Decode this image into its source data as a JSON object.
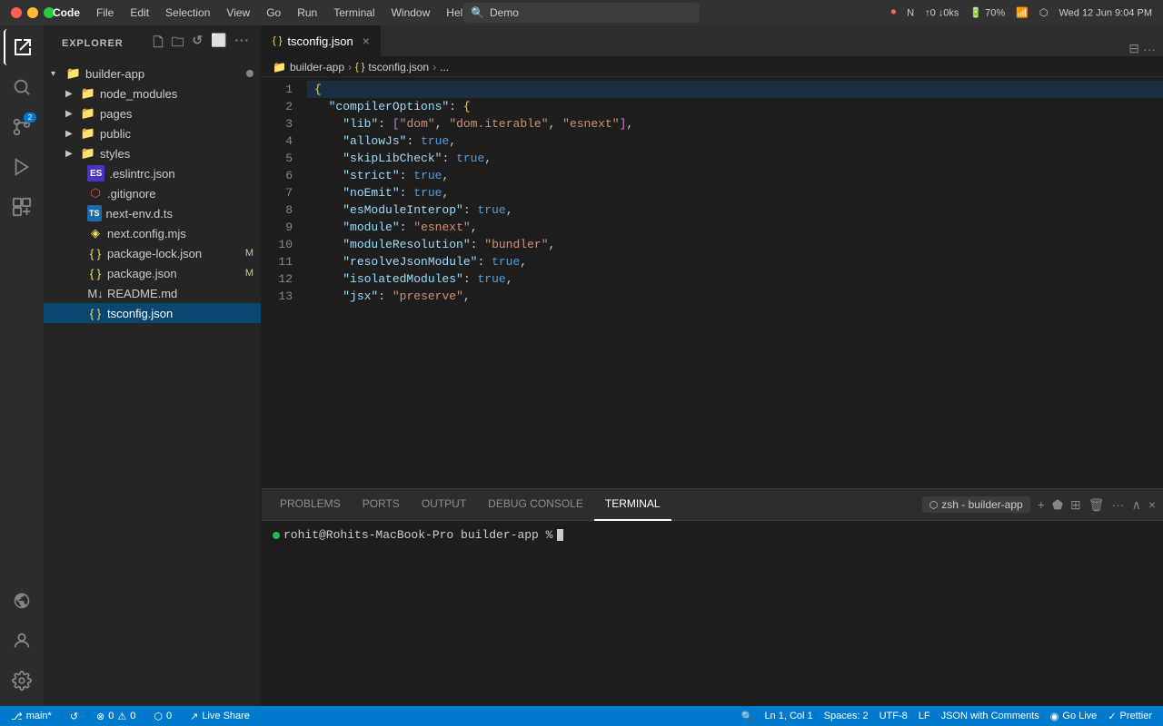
{
  "titlebar": {
    "menu_items": [
      "Code",
      "File",
      "Edit",
      "Selection",
      "View",
      "Go",
      "Run",
      "Terminal",
      "Window",
      "Help"
    ],
    "search_placeholder": "Demo",
    "time": "Wed 12 Jun  9:04 PM",
    "battery": "70%"
  },
  "activity_bar": {
    "icons": [
      {
        "name": "explorer-icon",
        "symbol": "⬡",
        "active": true
      },
      {
        "name": "search-icon",
        "symbol": "🔍",
        "active": false
      },
      {
        "name": "source-control-icon",
        "symbol": "⎇",
        "active": false,
        "badge": "2"
      },
      {
        "name": "extensions-icon",
        "symbol": "⊞",
        "active": false
      },
      {
        "name": "remote-icon",
        "symbol": "~",
        "active": false
      }
    ],
    "bottom_icons": [
      {
        "name": "accounts-icon",
        "symbol": "👤"
      },
      {
        "name": "settings-icon",
        "symbol": "⚙"
      }
    ]
  },
  "sidebar": {
    "title": "EXPLORER",
    "header_icons": [
      "new-file",
      "new-folder",
      "refresh",
      "collapse"
    ],
    "root_folder": "builder-app",
    "files": [
      {
        "type": "folder",
        "name": "node_modules",
        "indent": 1,
        "color": "node",
        "expanded": false
      },
      {
        "type": "folder",
        "name": "pages",
        "indent": 1,
        "color": "orange",
        "expanded": false
      },
      {
        "type": "folder",
        "name": "public",
        "indent": 1,
        "color": "orange",
        "expanded": false
      },
      {
        "type": "folder",
        "name": "styles",
        "indent": 1,
        "color": "orange",
        "expanded": false
      },
      {
        "type": "file",
        "name": ".eslintrc.json",
        "indent": 1,
        "icon": "eslint",
        "badge": ""
      },
      {
        "type": "file",
        "name": ".gitignore",
        "indent": 1,
        "icon": "git",
        "badge": ""
      },
      {
        "type": "file",
        "name": "next-env.d.ts",
        "indent": 1,
        "icon": "ts",
        "badge": ""
      },
      {
        "type": "file",
        "name": "next.config.mjs",
        "indent": 1,
        "icon": "mjs",
        "badge": ""
      },
      {
        "type": "file",
        "name": "package-lock.json",
        "indent": 1,
        "icon": "json",
        "badge": "M"
      },
      {
        "type": "file",
        "name": "package.json",
        "indent": 1,
        "icon": "json",
        "badge": "M"
      },
      {
        "type": "file",
        "name": "README.md",
        "indent": 1,
        "icon": "md",
        "badge": ""
      },
      {
        "type": "file",
        "name": "tsconfig.json",
        "indent": 1,
        "icon": "json",
        "badge": "",
        "active": true
      }
    ]
  },
  "tabs": [
    {
      "name": "tsconfig.json",
      "active": true,
      "icon": "json",
      "modified": false
    }
  ],
  "breadcrumb": {
    "items": [
      "builder-app",
      "tsconfig.json",
      "..."
    ]
  },
  "code": {
    "filename": "tsconfig.json",
    "lines": [
      {
        "num": 1,
        "content": "{"
      },
      {
        "num": 2,
        "content": "  \"compilerOptions\": {"
      },
      {
        "num": 3,
        "content": "    \"lib\": [\"dom\", \"dom.iterable\", \"esnext\"],"
      },
      {
        "num": 4,
        "content": "    \"allowJs\": true,"
      },
      {
        "num": 5,
        "content": "    \"skipLibCheck\": true,"
      },
      {
        "num": 6,
        "content": "    \"strict\": true,"
      },
      {
        "num": 7,
        "content": "    \"noEmit\": true,"
      },
      {
        "num": 8,
        "content": "    \"esModuleInterop\": true,"
      },
      {
        "num": 9,
        "content": "    \"module\": \"esnext\","
      },
      {
        "num": 10,
        "content": "    \"moduleResolution\": \"bundler\","
      },
      {
        "num": 11,
        "content": "    \"resolveJsonModule\": true,"
      },
      {
        "num": 12,
        "content": "    \"isolatedModules\": true,"
      },
      {
        "num": 13,
        "content": "    \"jsx\": \"preserve\","
      }
    ]
  },
  "panel": {
    "tabs": [
      "PROBLEMS",
      "PORTS",
      "OUTPUT",
      "DEBUG CONSOLE",
      "TERMINAL"
    ],
    "active_tab": "TERMINAL",
    "shell": "zsh - builder-app",
    "terminal_prompt": "rohit@Rohits-MacBook-Pro builder-app % "
  },
  "status_bar": {
    "branch": "main*",
    "sync_icon": "↺",
    "errors": "0",
    "warnings": "0",
    "info": "0",
    "position": "Ln 1, Col 1",
    "spaces": "Spaces: 2",
    "encoding": "UTF-8",
    "line_ending": "LF",
    "language": "JSON with Comments",
    "go_live": "Go Live",
    "prettier": "Prettier",
    "live_share": "Live Share",
    "port": "0"
  }
}
